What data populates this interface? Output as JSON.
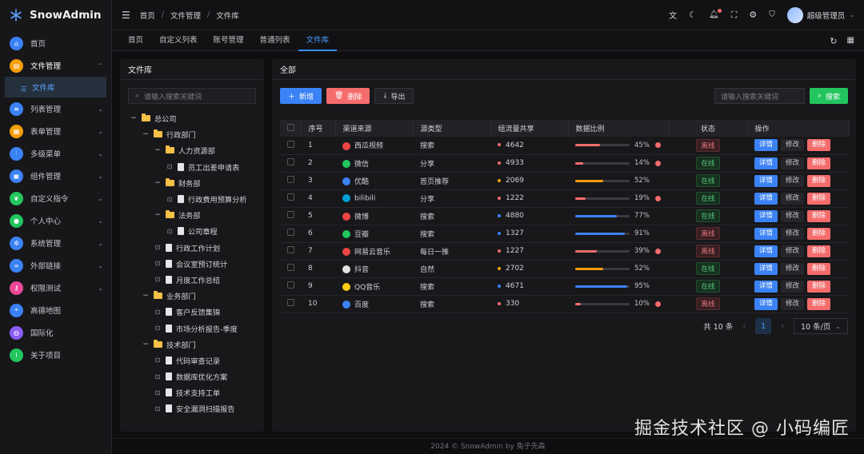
{
  "app": {
    "title": "SnowAdmin"
  },
  "sidebar": {
    "items": [
      {
        "label": "首页",
        "icon": "home-icon",
        "color": "#3b82f6",
        "has_children": false
      },
      {
        "label": "文件管理",
        "icon": "folder-icon",
        "color": "#f59e0b",
        "has_children": true,
        "open": true
      },
      {
        "label": "列表管理",
        "icon": "list-icon",
        "color": "#3b82f6",
        "has_children": true
      },
      {
        "label": "表单管理",
        "icon": "form-icon",
        "color": "#f59e0b",
        "has_children": true
      },
      {
        "label": "多级菜单",
        "icon": "sliders-icon",
        "color": "#3b82f6",
        "has_children": true
      },
      {
        "label": "组件管理",
        "icon": "grid-icon",
        "color": "#3b82f6",
        "has_children": true
      },
      {
        "label": "自定义指令",
        "icon": "leaf-icon",
        "color": "#22c55e",
        "has_children": true
      },
      {
        "label": "个人中心",
        "icon": "user-icon",
        "color": "#22c55e",
        "has_children": true
      },
      {
        "label": "系统管理",
        "icon": "settings-icon",
        "color": "#3b82f6",
        "has_children": true
      },
      {
        "label": "外部链接",
        "icon": "link-icon",
        "color": "#3b82f6",
        "has_children": true
      },
      {
        "label": "权限测试",
        "icon": "key-icon",
        "color": "#ec4899",
        "has_children": true
      },
      {
        "label": "高德地图",
        "icon": "map-icon",
        "color": "#3b82f6",
        "has_children": false
      },
      {
        "label": "国际化",
        "icon": "globe-icon",
        "color": "#8b5cf6",
        "has_children": false
      },
      {
        "label": "关于项目",
        "icon": "info-icon",
        "color": "#22c55e",
        "has_children": false
      }
    ],
    "submenu_active": "文件库"
  },
  "topbar": {
    "breadcrumb": [
      "首页",
      "文件管理",
      "文件库"
    ],
    "user_name": "超级管理员"
  },
  "tabs": [
    "首页",
    "自定义列表",
    "账号管理",
    "普通列表",
    "文件库"
  ],
  "active_tab_index": 4,
  "file_panel": {
    "title": "文件库",
    "search_placeholder": "请输入搜索关键词",
    "tree": [
      {
        "label": "总公司",
        "type": "folder",
        "level": 0,
        "toggle": "−"
      },
      {
        "label": "行政部门",
        "type": "folder",
        "level": 1,
        "toggle": "−"
      },
      {
        "label": "人力资源部",
        "type": "folder",
        "level": 2,
        "toggle": "−"
      },
      {
        "label": "员工出差申请表",
        "type": "file",
        "level": 3
      },
      {
        "label": "财务部",
        "type": "folder",
        "level": 2,
        "toggle": "−"
      },
      {
        "label": "行政费用预算分析",
        "type": "file",
        "level": 3
      },
      {
        "label": "法务部",
        "type": "folder",
        "level": 2,
        "toggle": "−"
      },
      {
        "label": "公司章程",
        "type": "file",
        "level": 3
      },
      {
        "label": "行政工作计划",
        "type": "file",
        "level": 2
      },
      {
        "label": "会议室预订统计",
        "type": "file",
        "level": 2
      },
      {
        "label": "月度工作总结",
        "type": "file",
        "level": 2
      },
      {
        "label": "业务部门",
        "type": "folder",
        "level": 1,
        "toggle": "−"
      },
      {
        "label": "客户反馈集锦",
        "type": "file",
        "level": 2
      },
      {
        "label": "市场分析报告-季度",
        "type": "file",
        "level": 2
      },
      {
        "label": "技术部门",
        "type": "folder",
        "level": 1,
        "toggle": "−"
      },
      {
        "label": "代码审查记录",
        "type": "file",
        "level": 2
      },
      {
        "label": "数据库优化方案",
        "type": "file",
        "level": 2
      },
      {
        "label": "技术支持工单",
        "type": "file",
        "level": 2
      },
      {
        "label": "安全漏洞扫描报告",
        "type": "file",
        "level": 2
      }
    ]
  },
  "main_panel": {
    "title": "全部",
    "buttons": {
      "add": "新增",
      "delete": "删除",
      "export": "导出",
      "search": "搜索"
    },
    "search_placeholder": "请输入搜索关键词",
    "columns": [
      "序号",
      "渠道来源",
      "源类型",
      "组流量共享",
      "数据比例",
      "状态",
      "操作"
    ],
    "rows": [
      {
        "no": "1",
        "source": "西瓜视频",
        "icon_color": "#ef4444",
        "type": "搜索",
        "traffic": "4642",
        "dot": "#f56c6c",
        "pct": 45,
        "pct_label": "45%",
        "bar_color": "#f56c6c",
        "warn": true,
        "status": "离线",
        "on": false
      },
      {
        "no": "2",
        "source": "微信",
        "icon_color": "#22c55e",
        "type": "分享",
        "traffic": "4933",
        "dot": "#f56c6c",
        "pct": 14,
        "pct_label": "14%",
        "bar_color": "#f56c6c",
        "warn": true,
        "status": "在线",
        "on": true
      },
      {
        "no": "3",
        "source": "优酷",
        "icon_color": "#3b82f6",
        "type": "首页推荐",
        "traffic": "2069",
        "dot": "#f59e0b",
        "pct": 52,
        "pct_label": "52%",
        "bar_color": "#f59e0b",
        "warn": false,
        "status": "在线",
        "on": true
      },
      {
        "no": "4",
        "source": "bilibili",
        "icon_color": "#00a1d6",
        "type": "分享",
        "traffic": "1222",
        "dot": "#f56c6c",
        "pct": 19,
        "pct_label": "19%",
        "bar_color": "#f56c6c",
        "warn": true,
        "status": "在线",
        "on": true
      },
      {
        "no": "5",
        "source": "微博",
        "icon_color": "#ef4444",
        "type": "搜索",
        "traffic": "4880",
        "dot": "#3b82f6",
        "pct": 77,
        "pct_label": "77%",
        "bar_color": "#3b82f6",
        "warn": false,
        "status": "在线",
        "on": true
      },
      {
        "no": "6",
        "source": "豆瓣",
        "icon_color": "#22c55e",
        "type": "搜索",
        "traffic": "1327",
        "dot": "#3b82f6",
        "pct": 91,
        "pct_label": "91%",
        "bar_color": "#3b82f6",
        "warn": false,
        "status": "离线",
        "on": false
      },
      {
        "no": "7",
        "source": "网易云音乐",
        "icon_color": "#ef4444",
        "type": "每日一推",
        "traffic": "1227",
        "dot": "#f56c6c",
        "pct": 39,
        "pct_label": "39%",
        "bar_color": "#f56c6c",
        "warn": true,
        "status": "离线",
        "on": false
      },
      {
        "no": "8",
        "source": "抖音",
        "icon_color": "#e4e4e7",
        "type": "自然",
        "traffic": "2702",
        "dot": "#f59e0b",
        "pct": 52,
        "pct_label": "52%",
        "bar_color": "#f59e0b",
        "warn": false,
        "status": "在线",
        "on": true
      },
      {
        "no": "9",
        "source": "QQ音乐",
        "icon_color": "#facc15",
        "type": "搜索",
        "traffic": "4671",
        "dot": "#3b82f6",
        "pct": 95,
        "pct_label": "95%",
        "bar_color": "#3b82f6",
        "warn": false,
        "status": "在线",
        "on": true
      },
      {
        "no": "10",
        "source": "百度",
        "icon_color": "#3b82f6",
        "type": "搜索",
        "traffic": "330",
        "dot": "#f56c6c",
        "pct": 10,
        "pct_label": "10%",
        "bar_color": "#f56c6c",
        "warn": true,
        "status": "离线",
        "on": false
      }
    ],
    "op_labels": {
      "detail": "详情",
      "edit": "修改",
      "delete": "删除"
    },
    "pagination": {
      "total": "共 10 条",
      "current": "1",
      "page_size": "10 条/页"
    }
  },
  "footer": "2024 © SnowAdmin by 兔子先森",
  "watermark": "掘金技术社区 @ 小码编匠"
}
